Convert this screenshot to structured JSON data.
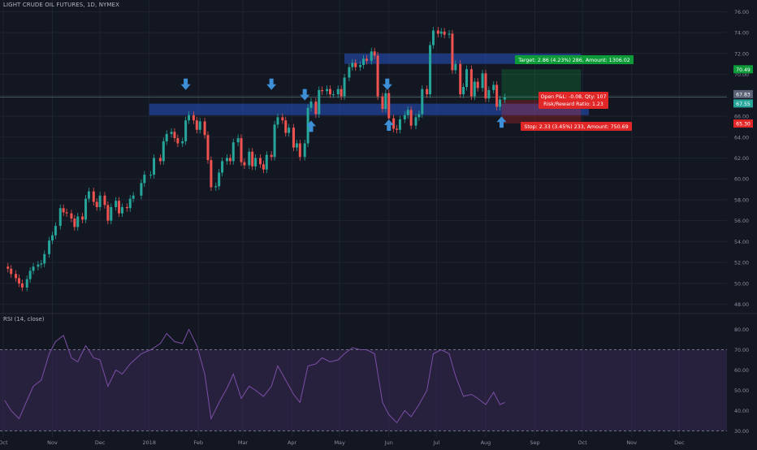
{
  "header": {
    "symbol_line": "LIGHT CRUDE OIL FUTURES, 1D, NYMEX"
  },
  "rsi": {
    "title": "RSI (14, close)",
    "ticks": [
      "80.00",
      "70.00",
      "60.00",
      "50.00",
      "40.00",
      "30.00"
    ]
  },
  "price_axis": {
    "ticks": [
      "76.00",
      "74.00",
      "72.00",
      "70.00",
      "68.00",
      "66.00",
      "64.00",
      "62.00",
      "60.00",
      "58.00",
      "56.00",
      "54.00",
      "52.00",
      "50.00",
      "48.00"
    ]
  },
  "time_axis": {
    "labels": [
      "Oct",
      "Nov",
      "Dec",
      "2018",
      "Feb",
      "Mar",
      "Apr",
      "May",
      "Jun",
      "Jul",
      "Aug",
      "Sep",
      "Oct",
      "Nov",
      "Dec"
    ]
  },
  "badges": {
    "target_price": "70.49",
    "current_price": "67.83",
    "entry_price": "67.55",
    "stop_price": "65.30"
  },
  "position": {
    "target_label": "Target: 2.86 (4.23%) 286, Amount: 1306.02",
    "open_pl_label": "Open P&L: -0.08, Qty: 107",
    "rr_label": "Risk/Reward Ratio: 1.23",
    "stop_label": "Stop: 2.33 (3.45%) 233, Amount: 750.69"
  },
  "colors": {
    "bull": "#26a69a",
    "bear": "#ef5350",
    "zone": "#2453c4",
    "rsi_line": "#7b4fa6",
    "rsi_band": "#3a2a55",
    "target": "#0d9a38",
    "stop": "#e02626",
    "arrow": "#3d8fd8"
  },
  "chart_data": {
    "type": "candlestick",
    "title": "LIGHT CRUDE OIL FUTURES, 1D, NYMEX",
    "ylim": [
      47.5,
      76.5
    ],
    "x_range": [
      "2017-09-29",
      "2018-12-31"
    ],
    "closes": [
      [
        "2017-10-02",
        51.6
      ],
      [
        "2017-10-04",
        51.4
      ],
      [
        "2017-10-06",
        50.9
      ],
      [
        "2017-10-09",
        50.5
      ],
      [
        "2017-10-11",
        50.0
      ],
      [
        "2017-10-13",
        49.6
      ],
      [
        "2017-10-16",
        50.4
      ],
      [
        "2017-10-18",
        51.2
      ],
      [
        "2017-10-20",
        51.6
      ],
      [
        "2017-10-23",
        51.8
      ],
      [
        "2017-10-25",
        51.9
      ],
      [
        "2017-10-27",
        52.8
      ],
      [
        "2017-10-30",
        54.1
      ],
      [
        "2017-11-01",
        54.6
      ],
      [
        "2017-11-03",
        55.5
      ],
      [
        "2017-11-06",
        57.2
      ],
      [
        "2017-11-08",
        56.8
      ],
      [
        "2017-11-10",
        56.7
      ],
      [
        "2017-11-13",
        56.2
      ],
      [
        "2017-11-15",
        55.4
      ],
      [
        "2017-11-17",
        56.4
      ],
      [
        "2017-11-20",
        56.1
      ],
      [
        "2017-11-22",
        58.1
      ],
      [
        "2017-11-24",
        58.8
      ],
      [
        "2017-11-27",
        57.8
      ],
      [
        "2017-11-29",
        57.3
      ],
      [
        "2017-12-01",
        58.4
      ],
      [
        "2017-12-04",
        57.5
      ],
      [
        "2017-12-06",
        56.0
      ],
      [
        "2017-12-08",
        57.3
      ],
      [
        "2017-12-11",
        57.9
      ],
      [
        "2017-12-13",
        56.7
      ],
      [
        "2017-12-15",
        57.3
      ],
      [
        "2017-12-18",
        57.2
      ],
      [
        "2017-12-20",
        58.1
      ],
      [
        "2017-12-22",
        58.4
      ],
      [
        "2017-12-27",
        59.6
      ],
      [
        "2017-12-29",
        60.4
      ],
      [
        "2018-01-02",
        60.4
      ],
      [
        "2018-01-04",
        62.0
      ],
      [
        "2018-01-08",
        61.7
      ],
      [
        "2018-01-10",
        63.6
      ],
      [
        "2018-01-12",
        64.3
      ],
      [
        "2018-01-15",
        64.5
      ],
      [
        "2018-01-17",
        63.9
      ],
      [
        "2018-01-19",
        63.4
      ],
      [
        "2018-01-22",
        63.6
      ],
      [
        "2018-01-24",
        65.6
      ],
      [
        "2018-01-26",
        66.1
      ],
      [
        "2018-01-29",
        65.6
      ],
      [
        "2018-01-31",
        64.7
      ],
      [
        "2018-02-02",
        65.5
      ],
      [
        "2018-02-05",
        64.2
      ],
      [
        "2018-02-07",
        61.8
      ],
      [
        "2018-02-09",
        59.2
      ],
      [
        "2018-02-12",
        59.3
      ],
      [
        "2018-02-14",
        60.6
      ],
      [
        "2018-02-16",
        61.7
      ],
      [
        "2018-02-19",
        62.0
      ],
      [
        "2018-02-21",
        61.7
      ],
      [
        "2018-02-23",
        63.5
      ],
      [
        "2018-02-26",
        63.9
      ],
      [
        "2018-02-28",
        61.6
      ],
      [
        "2018-03-02",
        61.3
      ],
      [
        "2018-03-05",
        62.6
      ],
      [
        "2018-03-07",
        61.2
      ],
      [
        "2018-03-09",
        62.0
      ],
      [
        "2018-03-12",
        61.4
      ],
      [
        "2018-03-14",
        60.9
      ],
      [
        "2018-03-16",
        62.3
      ],
      [
        "2018-03-19",
        62.1
      ],
      [
        "2018-03-21",
        65.2
      ],
      [
        "2018-03-23",
        65.9
      ],
      [
        "2018-03-26",
        65.6
      ],
      [
        "2018-03-28",
        64.4
      ],
      [
        "2018-03-30",
        64.9
      ],
      [
        "2018-04-02",
        63.0
      ],
      [
        "2018-04-04",
        63.4
      ],
      [
        "2018-04-06",
        62.1
      ],
      [
        "2018-04-09",
        63.4
      ],
      [
        "2018-04-11",
        66.8
      ],
      [
        "2018-04-13",
        67.4
      ],
      [
        "2018-04-16",
        66.2
      ],
      [
        "2018-04-18",
        68.5
      ],
      [
        "2018-04-20",
        68.4
      ],
      [
        "2018-04-23",
        68.6
      ],
      [
        "2018-04-25",
        68.1
      ],
      [
        "2018-04-27",
        68.1
      ],
      [
        "2018-04-30",
        68.6
      ],
      [
        "2018-05-02",
        67.9
      ],
      [
        "2018-05-04",
        69.7
      ],
      [
        "2018-05-07",
        70.7
      ],
      [
        "2018-05-09",
        71.1
      ],
      [
        "2018-05-11",
        70.7
      ],
      [
        "2018-05-14",
        70.9
      ],
      [
        "2018-05-16",
        71.5
      ],
      [
        "2018-05-18",
        71.3
      ],
      [
        "2018-05-21",
        72.2
      ],
      [
        "2018-05-23",
        71.8
      ],
      [
        "2018-05-25",
        67.9
      ],
      [
        "2018-05-28",
        66.7
      ],
      [
        "2018-05-30",
        68.2
      ],
      [
        "2018-06-01",
        65.8
      ],
      [
        "2018-06-04",
        64.8
      ],
      [
        "2018-06-06",
        64.7
      ],
      [
        "2018-06-08",
        65.7
      ],
      [
        "2018-06-11",
        66.1
      ],
      [
        "2018-06-13",
        66.6
      ],
      [
        "2018-06-15",
        65.1
      ],
      [
        "2018-06-18",
        65.9
      ],
      [
        "2018-06-20",
        66.2
      ],
      [
        "2018-06-22",
        68.6
      ],
      [
        "2018-06-25",
        68.1
      ],
      [
        "2018-06-27",
        72.8
      ],
      [
        "2018-06-29",
        74.2
      ],
      [
        "2018-07-02",
        73.9
      ],
      [
        "2018-07-04",
        74.1
      ],
      [
        "2018-07-06",
        73.8
      ],
      [
        "2018-07-09",
        73.9
      ],
      [
        "2018-07-11",
        70.4
      ],
      [
        "2018-07-13",
        71.0
      ],
      [
        "2018-07-16",
        68.1
      ],
      [
        "2018-07-18",
        68.8
      ],
      [
        "2018-07-20",
        70.5
      ],
      [
        "2018-07-23",
        67.9
      ],
      [
        "2018-07-25",
        69.3
      ],
      [
        "2018-07-27",
        68.7
      ],
      [
        "2018-07-30",
        70.1
      ],
      [
        "2018-08-01",
        67.7
      ],
      [
        "2018-08-03",
        68.5
      ],
      [
        "2018-08-06",
        69.0
      ],
      [
        "2018-08-08",
        66.9
      ],
      [
        "2018-08-10",
        67.6
      ],
      [
        "2018-08-13",
        67.8
      ]
    ],
    "rsi_14": [
      [
        "2017-10-02",
        45
      ],
      [
        "2017-10-06",
        40
      ],
      [
        "2017-10-11",
        36
      ],
      [
        "2017-10-16",
        45
      ],
      [
        "2017-10-20",
        52
      ],
      [
        "2017-10-25",
        55
      ],
      [
        "2017-10-30",
        68
      ],
      [
        "2017-11-03",
        74
      ],
      [
        "2017-11-08",
        77
      ],
      [
        "2017-11-13",
        66
      ],
      [
        "2017-11-17",
        64
      ],
      [
        "2017-11-22",
        72
      ],
      [
        "2017-11-27",
        66
      ],
      [
        "2017-12-01",
        65
      ],
      [
        "2017-12-06",
        52
      ],
      [
        "2017-12-11",
        60
      ],
      [
        "2017-12-15",
        58
      ],
      [
        "2017-12-20",
        63
      ],
      [
        "2017-12-27",
        68
      ],
      [
        "2018-01-02",
        70
      ],
      [
        "2018-01-08",
        73
      ],
      [
        "2018-01-12",
        78
      ],
      [
        "2018-01-17",
        74
      ],
      [
        "2018-01-22",
        73
      ],
      [
        "2018-01-26",
        80
      ],
      [
        "2018-01-31",
        72
      ],
      [
        "2018-02-05",
        58
      ],
      [
        "2018-02-09",
        36
      ],
      [
        "2018-02-14",
        44
      ],
      [
        "2018-02-19",
        51
      ],
      [
        "2018-02-23",
        58
      ],
      [
        "2018-02-28",
        46
      ],
      [
        "2018-03-05",
        52
      ],
      [
        "2018-03-09",
        50
      ],
      [
        "2018-03-14",
        47
      ],
      [
        "2018-03-19",
        52
      ],
      [
        "2018-03-23",
        62
      ],
      [
        "2018-03-28",
        55
      ],
      [
        "2018-04-02",
        48
      ],
      [
        "2018-04-06",
        44
      ],
      [
        "2018-04-11",
        62
      ],
      [
        "2018-04-16",
        63
      ],
      [
        "2018-04-20",
        66
      ],
      [
        "2018-04-25",
        64
      ],
      [
        "2018-04-30",
        65
      ],
      [
        "2018-05-04",
        68
      ],
      [
        "2018-05-09",
        71
      ],
      [
        "2018-05-14",
        70
      ],
      [
        "2018-05-18",
        70
      ],
      [
        "2018-05-23",
        68
      ],
      [
        "2018-05-28",
        44
      ],
      [
        "2018-06-01",
        38
      ],
      [
        "2018-06-06",
        34
      ],
      [
        "2018-06-11",
        40
      ],
      [
        "2018-06-15",
        37
      ],
      [
        "2018-06-20",
        43
      ],
      [
        "2018-06-25",
        50
      ],
      [
        "2018-06-29",
        68
      ],
      [
        "2018-07-04",
        70
      ],
      [
        "2018-07-09",
        68
      ],
      [
        "2018-07-13",
        57
      ],
      [
        "2018-07-18",
        47
      ],
      [
        "2018-07-23",
        48
      ],
      [
        "2018-07-27",
        46
      ],
      [
        "2018-08-01",
        43
      ],
      [
        "2018-08-06",
        49
      ],
      [
        "2018-08-10",
        43
      ],
      [
        "2018-08-13",
        44
      ]
    ],
    "rsi_ylim": [
      27,
      83
    ],
    "rsi_bands": [
      30,
      70
    ],
    "zones": [
      {
        "name": "resistance",
        "from": "2018-05-04",
        "to": "2018-09-30",
        "low": 71.0,
        "high": 72.0
      },
      {
        "name": "support",
        "from": "2018-01-01",
        "to": "2018-10-05",
        "low": 66.1,
        "high": 67.2
      }
    ],
    "long_position": {
      "start": "2018-08-11",
      "end": "2018-09-30",
      "entry": 67.55,
      "target": 70.49,
      "stop": 65.3,
      "current": 67.83
    },
    "arrows_down": [
      [
        "2018-01-24",
        68.9
      ],
      [
        "2018-03-19",
        68.9
      ],
      [
        "2018-04-09",
        67.9
      ],
      [
        "2018-05-31",
        68.9
      ]
    ],
    "arrows_up": [
      [
        "2018-04-13",
        65.2
      ],
      [
        "2018-06-01",
        65.3
      ],
      [
        "2018-08-11",
        65.6
      ]
    ],
    "dates_axis_ticks": [
      "2017-10-01",
      "2017-11-01",
      "2017-12-01",
      "2018-01-01",
      "2018-02-01",
      "2018-03-01",
      "2018-04-01",
      "2018-05-01",
      "2018-06-01",
      "2018-07-01",
      "2018-08-01",
      "2018-09-01",
      "2018-10-01",
      "2018-11-01",
      "2018-12-01"
    ]
  }
}
